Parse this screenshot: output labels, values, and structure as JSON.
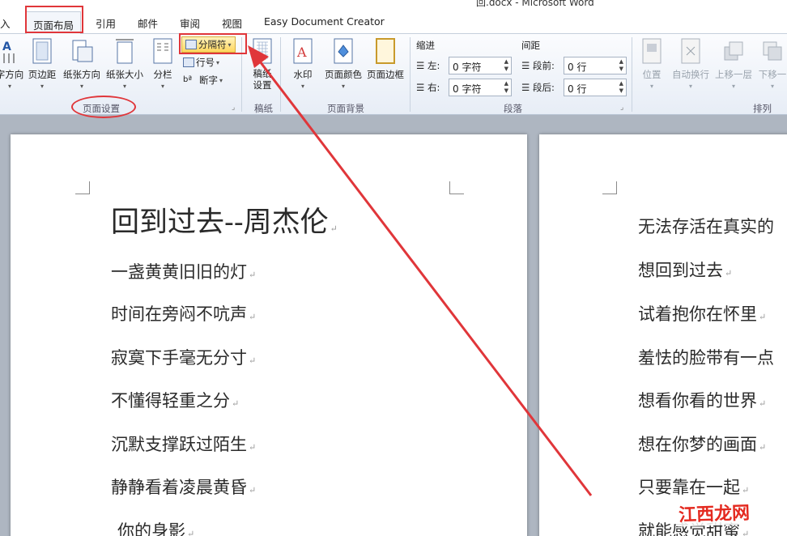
{
  "window": {
    "title": "回.docx - Microsoft Word"
  },
  "tabs": [
    {
      "label": "入",
      "active": false
    },
    {
      "label": "页面布局",
      "active": true
    },
    {
      "label": "引用",
      "active": false
    },
    {
      "label": "邮件",
      "active": false
    },
    {
      "label": "审阅",
      "active": false
    },
    {
      "label": "视图",
      "active": false
    },
    {
      "label": "Easy Document Creator",
      "active": false
    }
  ],
  "ribbon": {
    "page_setup": {
      "label": "页面设置",
      "buttons": [
        "字方向",
        "页边距",
        "纸张方向",
        "纸张大小",
        "分栏"
      ],
      "breaks": "分隔符",
      "line_numbers": "行号",
      "hyphenation": "断字"
    },
    "manuscript": {
      "label": "稿纸",
      "button": "稿纸设置"
    },
    "page_background": {
      "label": "页面背景",
      "buttons": [
        "水印",
        "页面颜色",
        "页面边框"
      ]
    },
    "paragraph": {
      "label": "段落",
      "indent_header": "缩进",
      "spacing_header": "间距",
      "indent_left_label": "左:",
      "indent_left_value": "0 字符",
      "indent_right_label": "右:",
      "indent_right_value": "0 字符",
      "space_before_label": "段前:",
      "space_before_value": "0 行",
      "space_after_label": "段后:",
      "space_after_value": "0 行"
    },
    "arrange": {
      "label": "排列",
      "buttons": [
        "位置",
        "自动换行",
        "上移一层",
        "下移一"
      ]
    }
  },
  "document": {
    "page1": {
      "title": "回到过去--周杰伦",
      "lines": [
        "一盏黄黄旧旧的灯",
        "时间在旁闷不吭声",
        "寂寞下手毫无分寸",
        "不懂得轻重之分",
        "沉默支撑跃过陌生",
        "静静看着凌晨黄昏",
        "你的身影"
      ]
    },
    "page2": {
      "lines": [
        "无法存活在真实的",
        "想回到过去",
        "试着抱你在怀里",
        "羞怯的脸带有一点",
        "想看你看的世界",
        "想在你梦的画面",
        "只要靠在一起",
        "就能感觉甜蜜"
      ]
    },
    "paragraph_mark": "↵"
  },
  "watermark": {
    "text": "江西龙网"
  },
  "colors": {
    "annotation_red": "#e0363a",
    "ribbon_bg": "#e7edf6",
    "workspace": "#aeb6c1"
  }
}
